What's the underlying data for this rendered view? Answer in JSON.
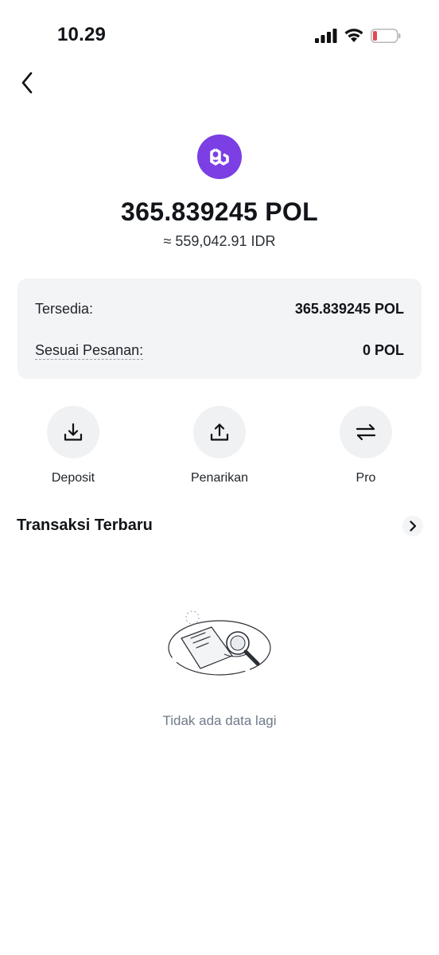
{
  "status_bar": {
    "time": "10.29",
    "icons": [
      "signal-icon",
      "wifi-icon",
      "battery-low-icon"
    ],
    "battery_color": "#e5484d"
  },
  "header": {
    "back_icon": "chevron-left-icon"
  },
  "coin": {
    "logo_icon": "polygon-logo-icon",
    "logo_color": "#7b3fe4",
    "balance": "365.839245 POL",
    "fiat_value": "≈ 559,042.91 IDR"
  },
  "info_card": {
    "rows": [
      {
        "label": "Tersedia:",
        "value": "365.839245 POL"
      },
      {
        "label": "Sesuai Pesanan:",
        "value": "0 POL"
      }
    ]
  },
  "actions": [
    {
      "label": "Deposit",
      "icon": "download-icon"
    },
    {
      "label": "Penarikan",
      "icon": "upload-icon"
    },
    {
      "label": "Pro",
      "icon": "swap-arrows-icon"
    }
  ],
  "transactions": {
    "title": "Transaksi Terbaru",
    "more_icon": "chevron-right-icon",
    "empty_text": "Tidak ada data lagi",
    "empty_icon": "document-search-icon"
  }
}
